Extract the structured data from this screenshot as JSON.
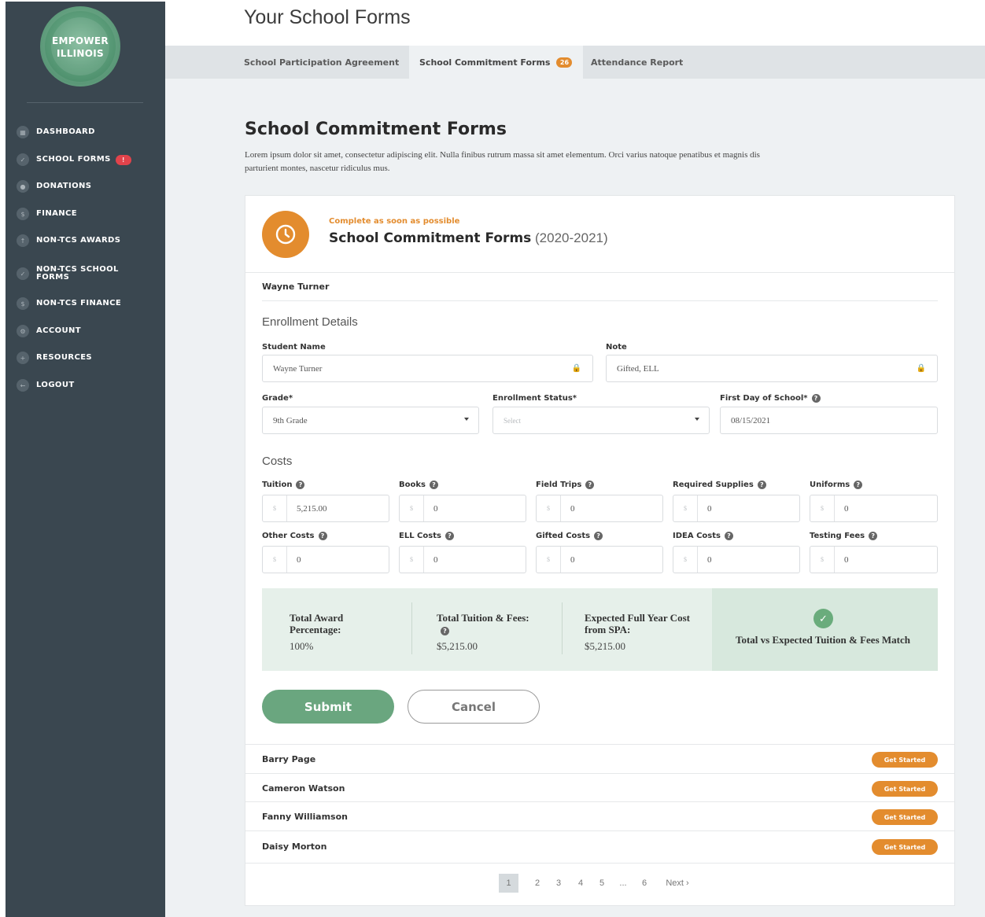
{
  "brand": {
    "logo_line1": "EMPOWER",
    "logo_line2": "ILLINOIS",
    "accent": "#e38c2e",
    "green": "#6aa67f",
    "sidebar_bg": "#3a4750"
  },
  "sidebar": {
    "items": [
      {
        "label": "DASHBOARD",
        "icon": "grid-icon"
      },
      {
        "label": "SCHOOL FORMS",
        "icon": "check-icon",
        "badge": "!"
      },
      {
        "label": "DONATIONS",
        "icon": "person-icon"
      },
      {
        "label": "FINANCE",
        "icon": "dollar-icon"
      },
      {
        "label": "NON-TCS AWARDS",
        "icon": "upload-icon"
      },
      {
        "label": "NON-TCS SCHOOL",
        "label2": "FORMS",
        "icon": "check-icon"
      },
      {
        "label": "NON-TCS FINANCE",
        "icon": "dollar-icon"
      },
      {
        "label": "ACCOUNT",
        "icon": "gear-icon"
      },
      {
        "label": "RESOURCES",
        "icon": "plus-icon"
      },
      {
        "label": "LOGOUT",
        "icon": "arrow-left-icon"
      }
    ]
  },
  "header": {
    "title": "Your School Forms",
    "tabs": [
      {
        "label": "School Participation Agreement"
      },
      {
        "label": "School Commitment Forms",
        "count": "26"
      },
      {
        "label": "Attendance Report"
      }
    ]
  },
  "main": {
    "title": "School Commitment Forms",
    "description": "Lorem ipsum dolor sit amet, consectetur adipiscing elit. Nulla finibus rutrum massa sit amet elementum. Orci varius natoque penatibus et magnis dis parturient montes, nascetur ridiculus mus.",
    "card": {
      "urgency": "Complete as soon as possible",
      "form_title": "School Commitment Forms",
      "form_year": "(2020-2021)",
      "student": "Wayne Turner",
      "enrollment_heading": "Enrollment Details",
      "fields": {
        "student_name_label": "Student Name",
        "student_name_value": "Wayne Turner",
        "note_label": "Note",
        "note_value": "Gifted, ELL",
        "grade_label": "Grade*",
        "grade_value": "9th Grade",
        "status_label": "Enrollment Status*",
        "status_placeholder": "Select",
        "first_day_label": "First Day of School*",
        "first_day_value": "08/15/2021"
      },
      "costs_heading": "Costs",
      "currency_symbol": "$",
      "costs": [
        {
          "label": "Tuition",
          "value": "5,215.00"
        },
        {
          "label": "Books",
          "value": "0"
        },
        {
          "label": "Field Trips",
          "value": "0"
        },
        {
          "label": "Required Supplies",
          "value": "0"
        },
        {
          "label": "Uniforms",
          "value": "0"
        },
        {
          "label": "Other Costs",
          "value": "0"
        },
        {
          "label": "ELL Costs",
          "value": "0"
        },
        {
          "label": "Gifted Costs",
          "value": "0"
        },
        {
          "label": "IDEA Costs",
          "value": "0"
        },
        {
          "label": "Testing Fees",
          "value": "0"
        }
      ],
      "summary": {
        "award_label": "Total Award Percentage:",
        "award_value": "100%",
        "tuition_label": "Total Tuition & Fees:",
        "tuition_value": "$5,215.00",
        "expected_label": "Expected Full Year Cost from SPA:",
        "expected_value": "$5,215.00",
        "match_text": "Total vs Expected Tuition & Fees Match"
      },
      "submit_label": "Submit",
      "cancel_label": "Cancel"
    },
    "students": [
      {
        "name": "Barry Page",
        "action": "Get Started"
      },
      {
        "name": "Cameron Watson",
        "action": "Get Started"
      },
      {
        "name": "Fanny Williamson",
        "action": "Get Started"
      },
      {
        "name": "Daisy Morton",
        "action": "Get Started"
      }
    ],
    "pagination": {
      "pages": [
        "1",
        "2",
        "3",
        "4",
        "5",
        "...",
        "6"
      ],
      "next": "Next ›",
      "current": "1"
    }
  }
}
